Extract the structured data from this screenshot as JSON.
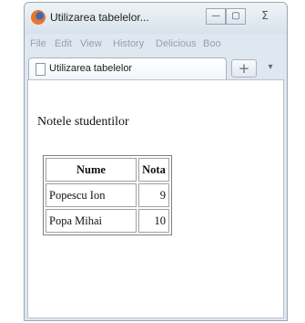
{
  "window": {
    "title": "Utilizarea tabelelor...",
    "buttons": {
      "minimize": "—",
      "maximize": "▢",
      "close": "Σ"
    }
  },
  "menubar": {
    "items": [
      "File",
      "Edit",
      "View",
      "History",
      "Delicious",
      "Boo"
    ]
  },
  "tabs": {
    "items": [
      {
        "label": "Utilizarea tabelelor"
      }
    ],
    "new_tab_label": "+",
    "list_tabs_label": "▾"
  },
  "page": {
    "heading": "Notele studentilor",
    "table": {
      "headers": [
        "Nume",
        "Nota"
      ],
      "rows": [
        [
          "Popescu Ion",
          "9"
        ],
        [
          "Popa Mihai",
          "10"
        ]
      ]
    }
  }
}
